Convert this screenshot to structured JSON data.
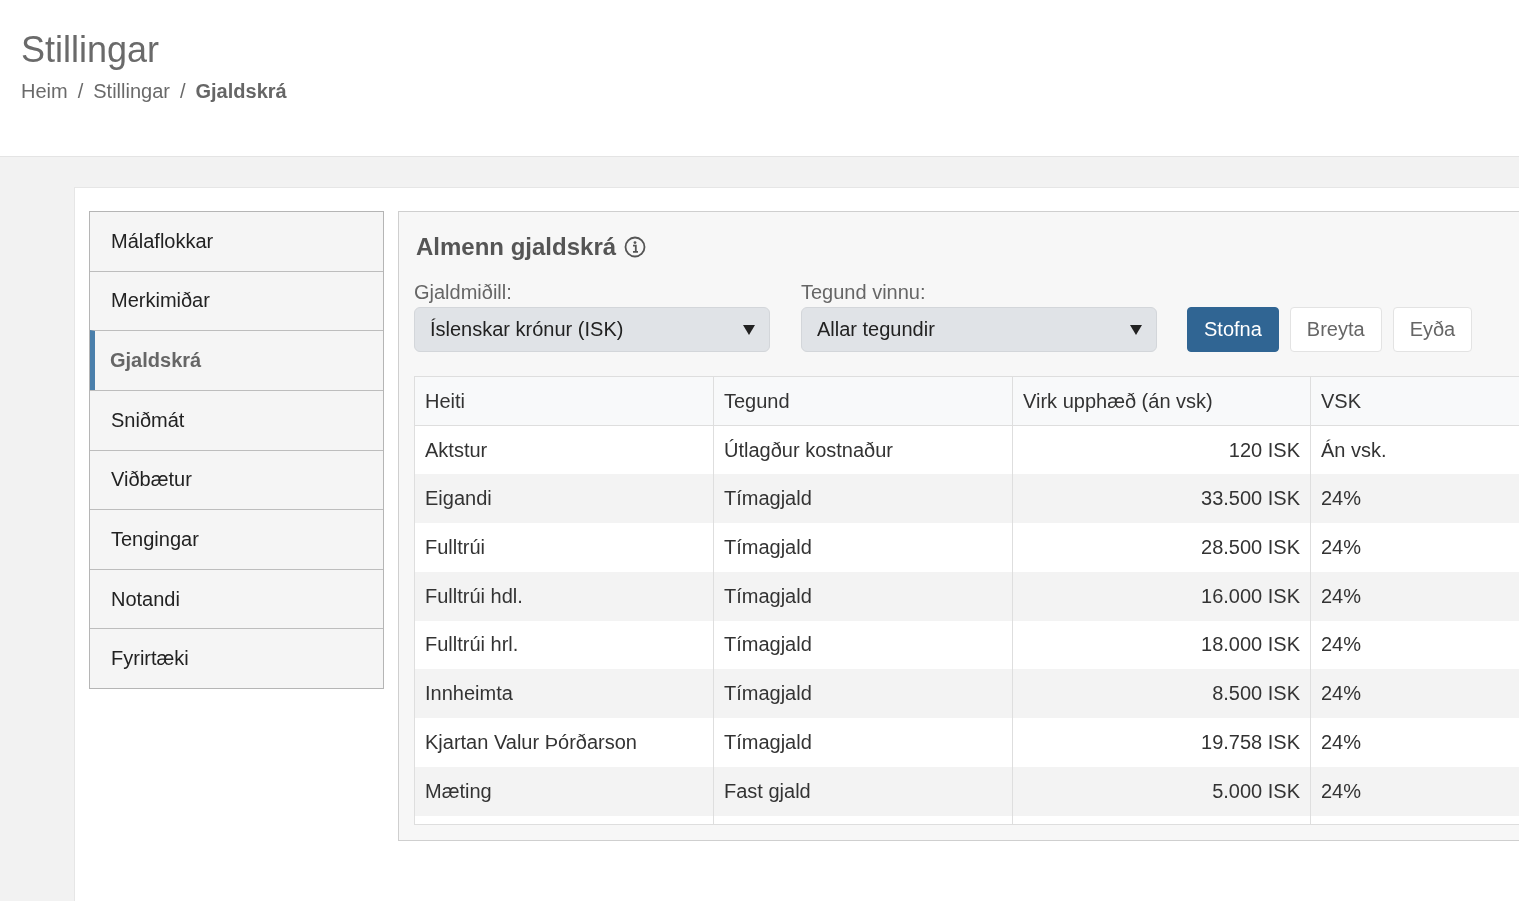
{
  "page": {
    "title": "Stillingar"
  },
  "breadcrumb": {
    "items": [
      {
        "label": "Heim",
        "current": false
      },
      {
        "label": "Stillingar",
        "current": false
      },
      {
        "label": "Gjaldskrá",
        "current": true
      }
    ],
    "separators": [
      "/",
      "/"
    ]
  },
  "sidebar": {
    "items": [
      {
        "label": "Málaflokkar",
        "selected": false
      },
      {
        "label": "Merkimiðar",
        "selected": false
      },
      {
        "label": "Gjaldskrá",
        "selected": true
      },
      {
        "label": "Sniðmát",
        "selected": false
      },
      {
        "label": "Viðbætur",
        "selected": false
      },
      {
        "label": "Tengingar",
        "selected": false
      },
      {
        "label": "Notandi",
        "selected": false
      },
      {
        "label": "Fyrirtæki",
        "selected": false
      }
    ]
  },
  "panel": {
    "title": "Almenn gjaldskrá",
    "filters": [
      {
        "label": "Gjaldmiðill:",
        "value": "Íslenskar krónur (ISK)"
      },
      {
        "label": "Tegund vinnu:",
        "value": "Allar tegundir"
      }
    ],
    "buttons": [
      {
        "label": "Stofna",
        "kind": "primary"
      },
      {
        "label": "Breyta",
        "kind": "default"
      },
      {
        "label": "Eyða",
        "kind": "default"
      }
    ],
    "table": {
      "columns": [
        "Heiti",
        "Tegund",
        "Virk upphæð (án vsk)",
        "VSK"
      ],
      "rows": [
        [
          "Aktstur",
          "Útlagður kostnaður",
          "120 ISK",
          "Án vsk."
        ],
        [
          "Eigandi",
          "Tímagjald",
          "33.500 ISK",
          "24%"
        ],
        [
          "Fulltrúi",
          "Tímagjald",
          "28.500 ISK",
          "24%"
        ],
        [
          "Fulltrúi hdl.",
          "Tímagjald",
          "16.000 ISK",
          "24%"
        ],
        [
          "Fulltrúi hrl.",
          "Tímagjald",
          "18.000 ISK",
          "24%"
        ],
        [
          "Innheimta",
          "Tímagjald",
          "8.500 ISK",
          "24%"
        ],
        [
          "Kjartan Valur Þórðarson",
          "Tímagjald",
          "19.758 ISK",
          "24%"
        ],
        [
          "Mæting",
          "Fast gjald",
          "5.000 ISK",
          "24%"
        ]
      ]
    }
  }
}
